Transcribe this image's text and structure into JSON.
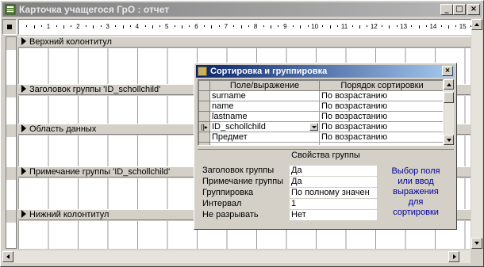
{
  "window": {
    "title": "Карточка учащегося ГрО : отчет",
    "min_label": "_",
    "max_label": "□",
    "close_label": "×"
  },
  "ruler": {
    "marks": [
      "1",
      "2",
      "3",
      "4",
      "5",
      "6",
      "7",
      "8",
      "9",
      "10",
      "11",
      "12",
      "13",
      "14",
      "15"
    ]
  },
  "bands": {
    "page_header": "Верхний колонтитул",
    "group_header": "Заголовок группы 'ID_schollchild'",
    "detail": "Область данных",
    "group_footer": "Примечание группы 'ID_schollchild'",
    "page_footer": "Нижний колонтитул"
  },
  "dialog": {
    "title": "Сортировка и группировка",
    "close_label": "×",
    "columns": [
      "Поле/выражение",
      "Порядок сортировки"
    ],
    "rows": [
      {
        "selector": "",
        "field": "surname",
        "order": "По возрастанию"
      },
      {
        "selector": "",
        "field": "name",
        "order": "По возрастанию"
      },
      {
        "selector": "",
        "field": "lastname",
        "order": "По возрастанию"
      },
      {
        "selector": "[[▸",
        "field": "ID_schollchild",
        "order": "По возрастанию"
      },
      {
        "selector": "",
        "field": "Предмет",
        "order": "По возрастанию"
      }
    ],
    "group_props_caption": "Свойства группы",
    "props": [
      {
        "label": "Заголовок группы",
        "value": "Да"
      },
      {
        "label": "Примечание группы",
        "value": "Да"
      },
      {
        "label": "Группировка",
        "value": "По полному значен"
      },
      {
        "label": "Интервал",
        "value": "1"
      },
      {
        "label": "Не разрывать",
        "value": "Нет"
      }
    ],
    "hint_lines": [
      "Выбор поля",
      "или ввод",
      "выражения",
      "для",
      "сортировки"
    ]
  }
}
